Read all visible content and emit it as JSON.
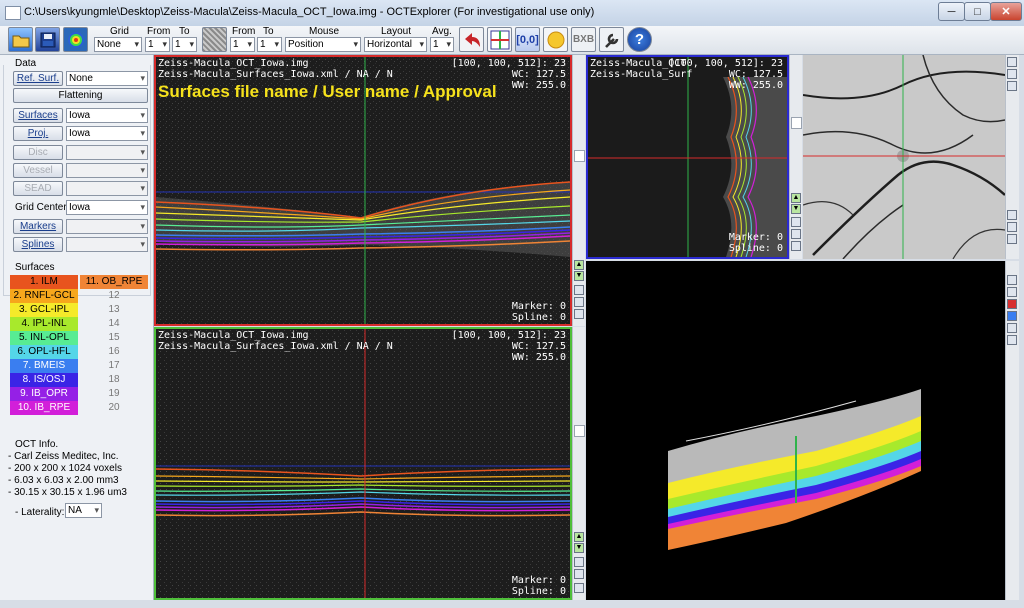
{
  "window": {
    "title": "C:\\Users\\kyungmle\\Desktop\\Zeiss-Macula\\Zeiss-Macula_OCT_Iowa.img - OCTExplorer (For investigational use only)",
    "minimize": "─",
    "maximize": "□",
    "close": "✕"
  },
  "toolbar": {
    "grid_label": "Grid",
    "grid_value": "None",
    "from_label": "From",
    "from_value": "1",
    "to_label": "To",
    "to_value": "1",
    "from2_label": "From",
    "from2_value": "1",
    "to2_label": "To",
    "to2_value": "1",
    "mouse_label": "Mouse",
    "mouse_value": "Position",
    "layout_label": "Layout",
    "layout_value": "Horizontal",
    "avg_label": "Avg.",
    "avg_value": "1",
    "coord_btn": "[0,0]",
    "bxb_btn": "BXB",
    "help_btn": "?"
  },
  "left": {
    "data_header": "Data",
    "ref_surf_btn": "Ref. Surf.",
    "ref_surf_value": "None",
    "flattening_btn": "Flattening",
    "surfaces_btn": "Surfaces",
    "surfaces_value": "Iowa",
    "proj_btn": "Proj.",
    "proj_value": "Iowa",
    "disc_btn": "Disc",
    "vessel_btn": "Vessel",
    "sead_btn": "SEAD",
    "grid_center_label": "Grid Center",
    "grid_center_value": "Iowa",
    "markers_btn": "Markers",
    "splines_btn": "Splines",
    "surfaces_header": "Surfaces",
    "surfaces": [
      {
        "label": "1. ILM",
        "color": "#e8541e"
      },
      {
        "label": "2. RNFL-GCL",
        "color": "#f6a71c"
      },
      {
        "label": "3. GCL-IPL",
        "color": "#f5ea2a"
      },
      {
        "label": "4. IPL-INL",
        "color": "#a8e92c"
      },
      {
        "label": "5. INL-OPL",
        "color": "#58ec93"
      },
      {
        "label": "6. OPL-HFL",
        "color": "#54d6e8"
      },
      {
        "label": "7. BMEIS",
        "color": "#3a7ef0"
      },
      {
        "label": "8. IS/OSJ",
        "color": "#3a24e6"
      },
      {
        "label": "9. IB_OPR",
        "color": "#9520e6"
      },
      {
        "label": "10. IB_RPE",
        "color": "#d21fd9"
      }
    ],
    "surfaces_right": [
      {
        "label": "11. OB_RPE",
        "color": "#f08436"
      },
      {
        "label": "12"
      },
      {
        "label": "13"
      },
      {
        "label": "14"
      },
      {
        "label": "15"
      },
      {
        "label": "16"
      },
      {
        "label": "17"
      },
      {
        "label": "18"
      },
      {
        "label": "19"
      },
      {
        "label": "20"
      }
    ],
    "oct_info_header": "OCT Info.",
    "oct_info": [
      "- Carl Zeiss Meditec, Inc.",
      "- 200 x 200 x 1024 voxels",
      "- 6.03 x 6.03 x 2.00 mm3",
      "- 30.15 x 30.15 x 1.96 um3"
    ],
    "laterality_label": "- Laterality:",
    "laterality_value": "NA"
  },
  "view1": {
    "name1": "Zeiss-Macula_OCT_Iowa.img",
    "name2": "Zeiss-Macula_Surfaces_Iowa.xml / NA / N",
    "coords": "[100, 100, 512]: 23",
    "wc": "WC: 127.5",
    "ww": "WW: 255.0",
    "overlay": "Surfaces file name / User name / Approval",
    "marker": "Marker: 0",
    "spline": "Spline: 0"
  },
  "view2": {
    "name1": "Zeiss-Macula_OCT_Iowa.img",
    "name2": "Zeiss-Macula_Surfaces_Iowa.xml / NA / N",
    "coords": "[100, 100, 512]: 23",
    "wc": "WC: 127.5",
    "ww": "WW: 255.0",
    "marker": "Marker: 0",
    "spline": "Spline: 0"
  },
  "view3": {
    "name1": "Zeiss-Macula_OCT",
    "name2": "Zeiss-Macula_Surf",
    "coords": "[100, 100, 512]: 23",
    "wc": "WC: 127.5",
    "ww": "WW: 255.0",
    "marker": "Marker: 0",
    "spline": "Spline: 0"
  },
  "colors": {
    "view1_border": "#d62b2b",
    "view2_border": "#4fbf3a",
    "view3_border": "#2a2ad0",
    "overlay_text": "#f6e21c"
  }
}
